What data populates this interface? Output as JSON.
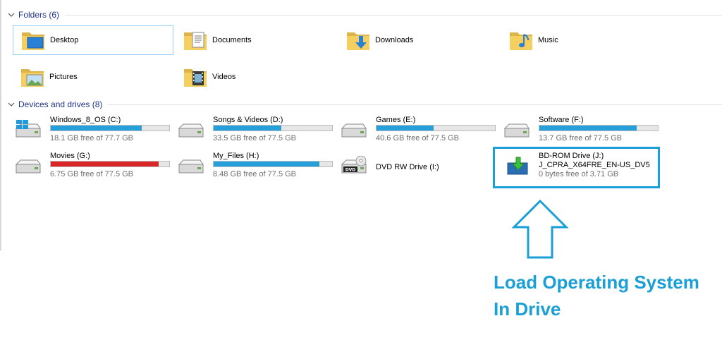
{
  "folders": {
    "header": "Folders (6)",
    "items": [
      {
        "name": "Desktop",
        "icon": "desktop-folder-icon"
      },
      {
        "name": "Documents",
        "icon": "documents-folder-icon"
      },
      {
        "name": "Downloads",
        "icon": "downloads-folder-icon"
      },
      {
        "name": "Music",
        "icon": "music-folder-icon"
      },
      {
        "name": "Pictures",
        "icon": "pictures-folder-icon"
      },
      {
        "name": "Videos",
        "icon": "videos-folder-icon"
      }
    ]
  },
  "drives": {
    "header": "Devices and drives (8)",
    "items": [
      {
        "name": "Windows_8_OS (C:)",
        "free": "18.1 GB free of 77.7 GB",
        "used_fraction": 0.77,
        "icon": "windows-drive-icon"
      },
      {
        "name": "Songs & Videos (D:)",
        "free": "33.5 GB free of 77.5 GB",
        "used_fraction": 0.57,
        "icon": "hard-drive-icon"
      },
      {
        "name": "Games (E:)",
        "free": "40.6 GB free of 77.5 GB",
        "used_fraction": 0.48,
        "icon": "hard-drive-icon"
      },
      {
        "name": "Software (F:)",
        "free": "13.7 GB free of 77.5 GB",
        "used_fraction": 0.82,
        "icon": "hard-drive-icon"
      },
      {
        "name": "Movies (G:)",
        "free": "6.75 GB free of 77.5 GB",
        "used_fraction": 0.91,
        "icon": "hard-drive-icon",
        "low": true
      },
      {
        "name": "My_Files (H:)",
        "free": "8.48 GB free of 77.5 GB",
        "used_fraction": 0.89,
        "icon": "hard-drive-icon"
      },
      {
        "name": "DVD RW Drive (I:)",
        "icon": "dvd-drive-icon"
      },
      {
        "name": "BD-ROM Drive (J:)",
        "label": "J_CPRA_X64FRE_EN-US_DV5",
        "free": "0 bytes free of 3.71 GB",
        "icon": "bd-rom-drive-icon"
      }
    ]
  },
  "annotation": {
    "line1": "Load Operating System",
    "line2": "In Drive",
    "color": "#1a9fd6"
  },
  "colors": {
    "accent": "#26a0da",
    "low_space": "#da2626",
    "header_text": "#1e3287"
  }
}
